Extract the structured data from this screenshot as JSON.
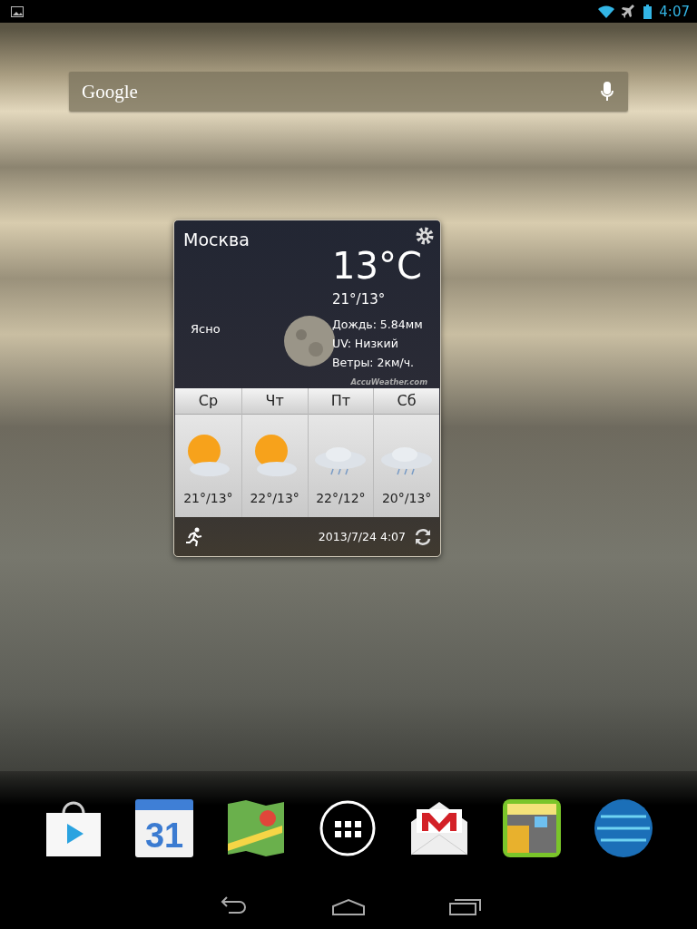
{
  "status_bar": {
    "time": "4:07"
  },
  "search": {
    "placeholder": "Google"
  },
  "weather": {
    "city": "Москва",
    "temperature": "13°C",
    "high_low": "21°/13°",
    "condition": "Ясно",
    "details": [
      "Дождь: 5.84мм",
      "UV: Низкий",
      "Ветры: 2км/ч."
    ],
    "provider": "AccuWeather.com",
    "updated": "2013/7/24 4:07",
    "forecast": [
      {
        "day": "Ср",
        "kind": "sunny-cloudy",
        "temps": "21°/13°"
      },
      {
        "day": "Чт",
        "kind": "sunny-cloudy",
        "temps": "22°/13°"
      },
      {
        "day": "Пт",
        "kind": "rain",
        "temps": "22°/12°"
      },
      {
        "day": "Сб",
        "kind": "rain",
        "temps": "20°/13°"
      }
    ]
  },
  "dock": [
    {
      "kind": "store"
    },
    {
      "kind": "calendar",
      "label": "31"
    },
    {
      "kind": "maps"
    },
    {
      "kind": "apps"
    },
    {
      "kind": "mail"
    },
    {
      "kind": "game"
    },
    {
      "kind": "globe"
    }
  ]
}
